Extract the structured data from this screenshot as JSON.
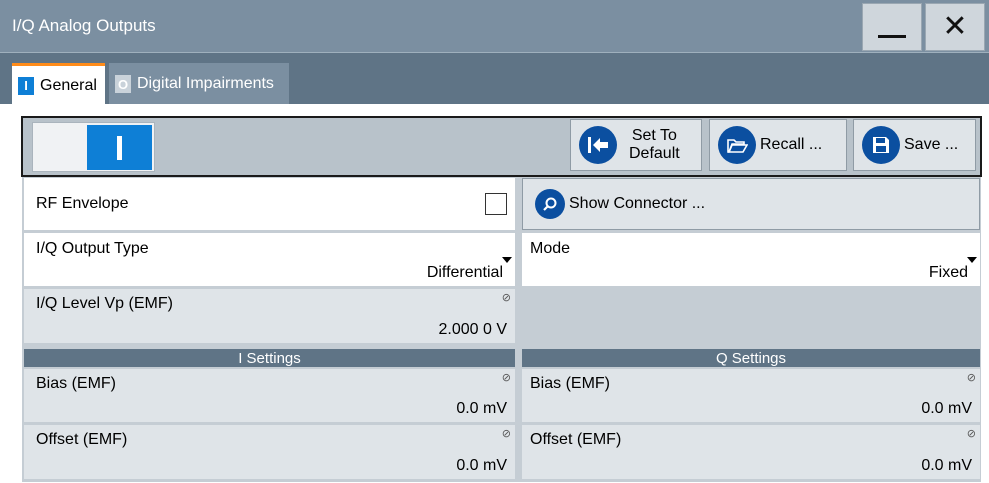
{
  "window": {
    "title": "I/Q Analog Outputs",
    "minimize_symbol": "_",
    "close_symbol": "✕"
  },
  "tabs": [
    {
      "badge": "I",
      "label": "General",
      "active": true
    },
    {
      "badge": "O",
      "label": "Digital Impairments",
      "active": false
    }
  ],
  "toolbar": {
    "state": "on",
    "set_default_line1": "Set To",
    "set_default_line2": "Default",
    "recall_label": "Recall ...",
    "save_label": "Save ..."
  },
  "rf_envelope": {
    "label": "RF Envelope",
    "checked": false
  },
  "show_connector_label": "Show Connector ...",
  "iq_output_type": {
    "label": "I/Q Output Type",
    "value": "Differential"
  },
  "mode": {
    "label": "Mode",
    "value": "Fixed"
  },
  "iq_level": {
    "label": "I/Q Level Vp (EMF)",
    "value": "2.000 0 V"
  },
  "i_settings": {
    "header": "I Settings",
    "bias_label": "Bias (EMF)",
    "bias_value": "0.0 mV",
    "offset_label": "Offset (EMF)",
    "offset_value": "0.0 mV"
  },
  "q_settings": {
    "header": "Q Settings",
    "bias_label": "Bias (EMF)",
    "bias_value": "0.0 mV",
    "offset_label": "Offset (EMF)",
    "offset_value": "0.0 mV"
  },
  "colors": {
    "titlebar": "#7b8fa1",
    "tabbar": "#5f7486",
    "accent_blue": "#0e7fd6",
    "icon_blue": "#0b4fa0",
    "tab_active_border": "#ff8c1a",
    "panel": "#c5cdd4"
  }
}
